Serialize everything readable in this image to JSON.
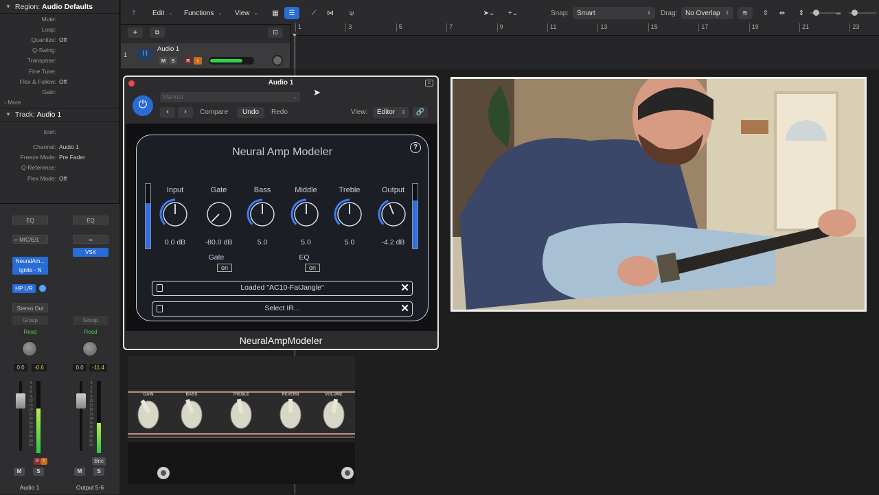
{
  "inspector": {
    "region_header": "Region:",
    "region_name": "Audio Defaults",
    "region_rows": [
      {
        "label": "Mute:",
        "value": ""
      },
      {
        "label": "Loop:",
        "value": ""
      },
      {
        "label": "Quantize:",
        "value": "Off"
      },
      {
        "label": "Q-Swing:",
        "value": ""
      },
      {
        "label": "Transpose:",
        "value": ""
      },
      {
        "label": "Fine Tune:",
        "value": ""
      },
      {
        "label": "Flex & Follow:",
        "value": "Off"
      },
      {
        "label": "Gain:",
        "value": ""
      }
    ],
    "more": "More",
    "track_header": "Track:",
    "track_name": "Audio 1",
    "track_rows": [
      {
        "label": "Icon:",
        "value": ""
      },
      {
        "label": "Channel:",
        "value": "Audio 1"
      },
      {
        "label": "Freeze Mode:",
        "value": "Pre Fader"
      },
      {
        "label": "Q-Reference:",
        "value": ""
      },
      {
        "label": "Flex Mode:",
        "value": "Off"
      }
    ]
  },
  "mixer": {
    "strip1": {
      "eq": "EQ",
      "input": "MIC/E/1",
      "plugin1": "NeuralAm...",
      "plugin2": "Ignite - N",
      "send": "HP L/R",
      "output": "Stereo Out",
      "group": "Group",
      "automation": "Read",
      "vol": "0.0",
      "peak": "-0.6",
      "mute": "M",
      "solo": "S",
      "name": "Audio 1",
      "meter_level": 0.62,
      "r": "R",
      "i": "I"
    },
    "strip2": {
      "eq": "EQ",
      "input": "∞",
      "plugin1": "VSX",
      "group": "Group",
      "automation": "Read",
      "vol": "0.0",
      "peak": "-11.4",
      "mute": "M",
      "solo": "S",
      "name": "Output 5-6",
      "bnc": "Bnc",
      "meter_level": 0.42
    },
    "scale": [
      "0",
      "3",
      "6",
      "9",
      "12",
      "15",
      "18",
      "21",
      "24",
      "30",
      "35",
      "40",
      "45",
      "50",
      "60"
    ]
  },
  "toolbar": {
    "edit": "Edit",
    "functions": "Functions",
    "view": "View",
    "snap_label": "Snap:",
    "snap_value": "Smart",
    "drag_label": "Drag:",
    "drag_value": "No Overlap"
  },
  "tracks": {
    "number": "1",
    "name": "Audio 1",
    "mute": "M",
    "solo": "S",
    "rec": "R",
    "input": "I",
    "volume_level": 0.75
  },
  "ruler": [
    "1",
    "3",
    "5",
    "7",
    "9",
    "11",
    "13",
    "15",
    "17",
    "19",
    "21",
    "23"
  ],
  "plugin": {
    "window_title": "Audio 1",
    "preset": "Manual",
    "compare": "Compare",
    "undo": "Undo",
    "redo": "Redo",
    "view_label": "View:",
    "view_value": "Editor",
    "nam_title": "Neural Amp Modeler",
    "help": "?",
    "knobs": [
      {
        "label": "Input",
        "value": "0.0 dB",
        "level": 0.5
      },
      {
        "label": "Gate",
        "value": "-80.0 dB",
        "level": 0.0
      },
      {
        "label": "Bass",
        "value": "5.0",
        "level": 0.5
      },
      {
        "label": "Middle",
        "value": "5.0",
        "level": 0.5
      },
      {
        "label": "Treble",
        "value": "5.0",
        "level": 0.5
      },
      {
        "label": "Output",
        "value": "-4.2 dB",
        "level": 0.42
      }
    ],
    "gate_label": "Gate",
    "gate_toggle": "on",
    "eq_label": "EQ",
    "eq_toggle": "on",
    "model_file": "Loaded \"AC10-FatJangle\"",
    "ir_file": "Select IR...",
    "footer": "NeuralAmpModeler",
    "input_meter": 0.7,
    "output_meter": 0.75
  },
  "amp": {
    "labels": [
      "GAIN",
      "BASS",
      "TREBLE",
      "REVERB",
      "VOLUME"
    ]
  }
}
